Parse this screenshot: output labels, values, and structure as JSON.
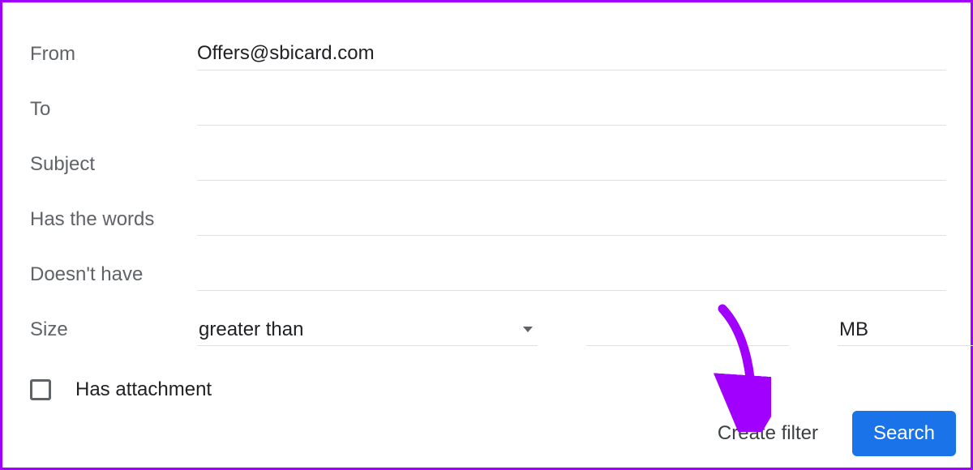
{
  "filter": {
    "from_label": "From",
    "from_value": "Offers@sbicard.com",
    "to_label": "To",
    "to_value": "",
    "subject_label": "Subject",
    "subject_value": "",
    "has_words_label": "Has the words",
    "has_words_value": "",
    "doesnt_have_label": "Doesn't have",
    "doesnt_have_value": "",
    "size_label": "Size",
    "size_comparator": "greater than",
    "size_value": "",
    "size_unit": "MB",
    "has_attachment_label": "Has attachment",
    "has_attachment_checked": false
  },
  "actions": {
    "create_filter": "Create filter",
    "search": "Search"
  },
  "colors": {
    "annotation": "#a100ff",
    "primary": "#1a73e8"
  }
}
